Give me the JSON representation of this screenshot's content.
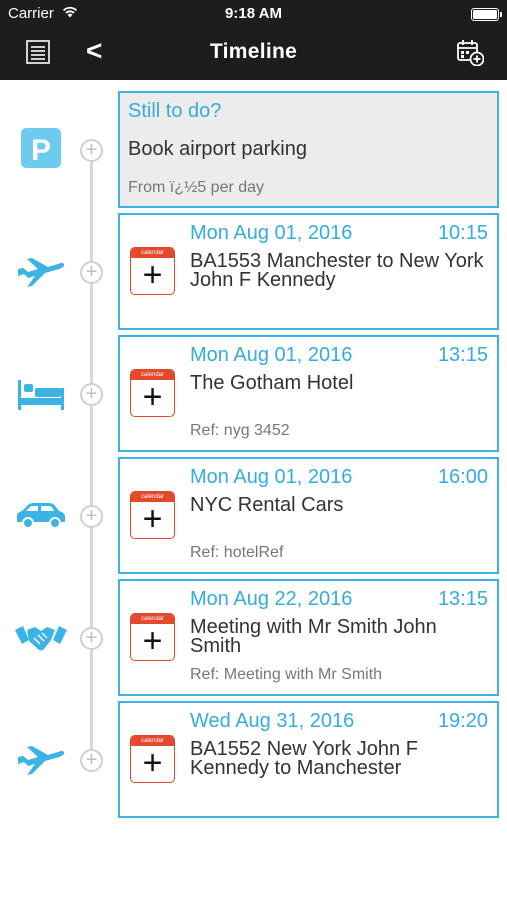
{
  "status_bar": {
    "carrier": "Carrier",
    "time": "9:18 AM"
  },
  "nav": {
    "title": "Timeline",
    "back_label": "<"
  },
  "todo": {
    "heading": "Still to do?",
    "title": "Book airport parking",
    "subtitle": "From ï¿½5 per day",
    "icon": "parking-icon"
  },
  "calendar_badge": {
    "header": "calendar",
    "plus": "+"
  },
  "timeline_dot": "+",
  "events": [
    {
      "icon": "plane-icon",
      "date": "Mon Aug 01, 2016",
      "time": "10:15",
      "title": "BA1553 Manchester to New York John F Kennedy",
      "ref": ""
    },
    {
      "icon": "hotel-bed-icon",
      "date": "Mon Aug 01, 2016",
      "time": "13:15",
      "title": "The Gotham Hotel",
      "ref": "Ref: nyg 3452"
    },
    {
      "icon": "car-icon",
      "date": "Mon Aug 01, 2016",
      "time": "16:00",
      "title": "NYC Rental Cars",
      "ref": "Ref: hotelRef"
    },
    {
      "icon": "handshake-icon",
      "date": "Mon Aug 22, 2016",
      "time": "13:15",
      "title": "Meeting with Mr Smith John Smith",
      "ref": "Ref: Meeting with Mr Smith"
    },
    {
      "icon": "plane-icon",
      "date": "Wed Aug 31, 2016",
      "time": "19:20",
      "title": "BA1552 New York John F Kennedy to Manchester",
      "ref": ""
    }
  ],
  "colors": {
    "accent": "#3bb3e4",
    "bar": "#1d1d1d",
    "calendar_red": "#e4492c",
    "todo_bg": "#ececec"
  }
}
